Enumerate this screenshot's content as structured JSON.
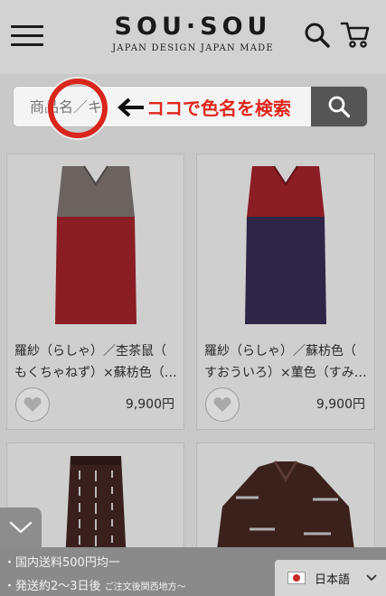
{
  "header": {
    "logo_main": "SOU·SOU",
    "logo_sub": "JAPAN DESIGN JAPAN MADE"
  },
  "search": {
    "placeholder": "商品名／キ",
    "annotation": "ココで色名を検索"
  },
  "products": [
    {
      "name_line1": "羅紗（らしゃ）／杢茶鼠（",
      "name_line2": "もくちゃねず）×蘇枋色（…",
      "price": "9,900円",
      "colors": {
        "top": "#6a6360",
        "bottom": "#8b1d24"
      }
    },
    {
      "name_line1": "羅紗（らしゃ）／蘇枋色（",
      "name_line2": "すおういろ）×菫色（すみ…",
      "price": "9,900円",
      "colors": {
        "top": "#8b1d24",
        "bottom": "#2e2547"
      }
    },
    {
      "colors": {
        "main": "#3a201c",
        "stripe": "#b9b9b9"
      }
    },
    {
      "colors": {
        "main": "#3b211c",
        "stripe": "#b0b0b0"
      }
    }
  ],
  "footer": {
    "line1": "・国内送料500円均一",
    "line2": "・発送約2〜3日後",
    "line2_small": "ご注文後関西地方〜",
    "language": "日本語"
  },
  "icons": [
    "menu-icon",
    "search-icon",
    "cart-icon",
    "heart-icon",
    "chevron-down-icon",
    "japan-flag-icon",
    "arrow-left-icon"
  ]
}
